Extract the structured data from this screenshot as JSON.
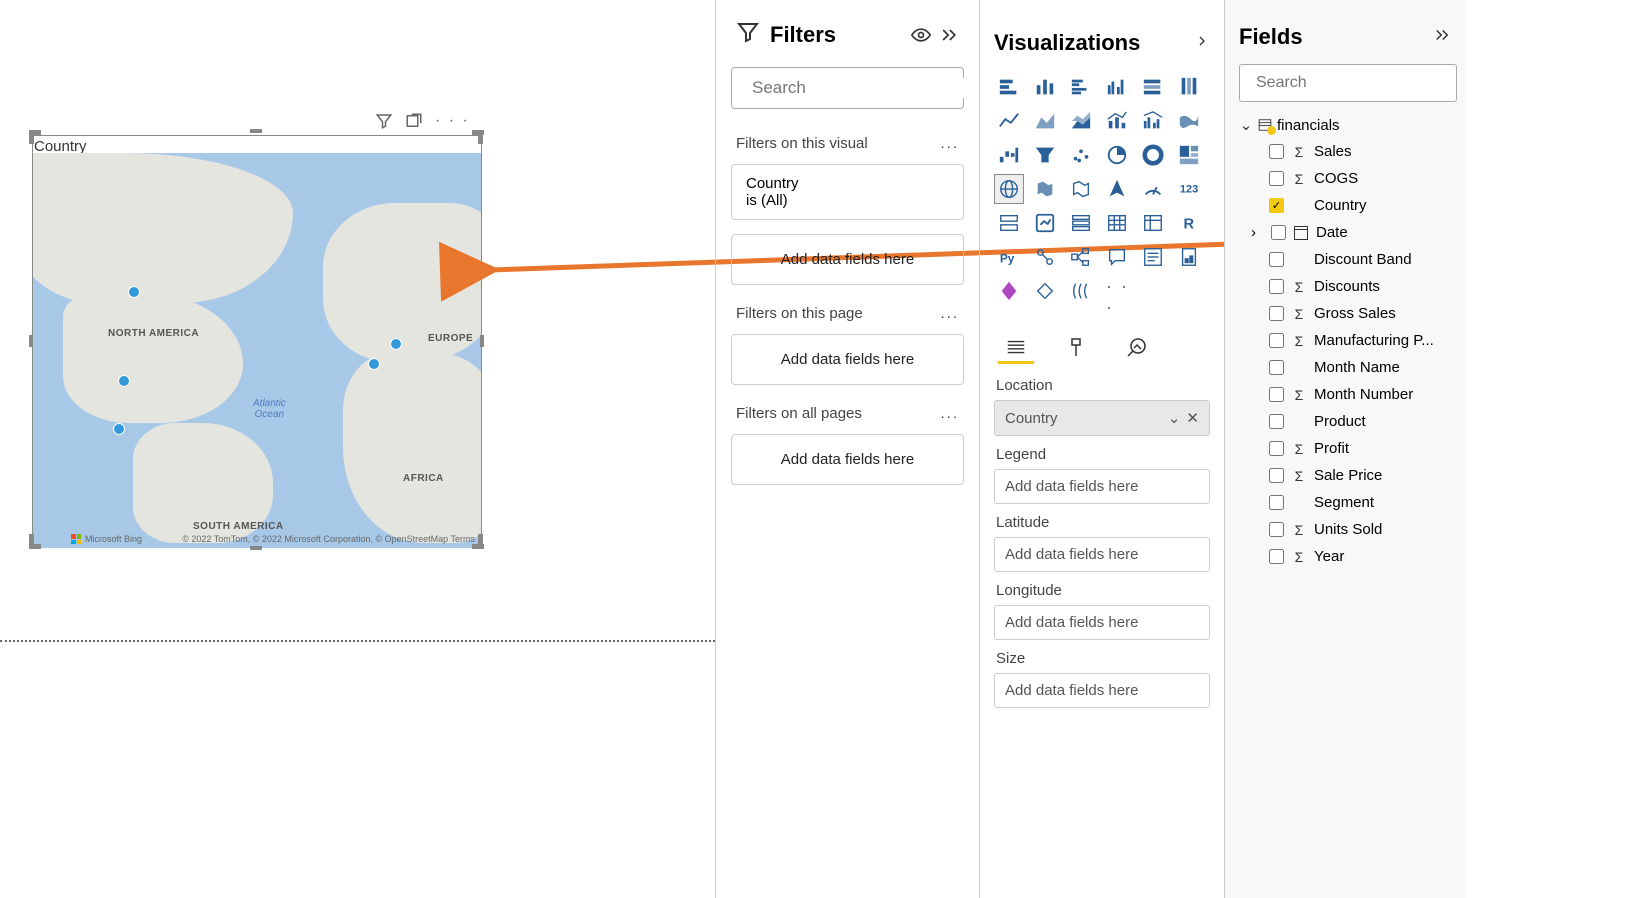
{
  "canvas": {
    "map_title": "Country",
    "continents": {
      "north_america": "NORTH AMERICA",
      "south_america": "SOUTH AMERICA",
      "europe": "EUROPE",
      "africa": "AFRICA"
    },
    "ocean": "Atlantic\nOcean",
    "attribution_vendor": "Microsoft Bing",
    "attribution_text": "© 2022 TomTom, © 2022 Microsoft Corporation,",
    "attribution_link": "© OpenStreetMap",
    "attribution_terms": "Terms"
  },
  "filters": {
    "title": "Filters",
    "search_placeholder": "Search",
    "sections": {
      "visual": {
        "title": "Filters on this visual",
        "card_field": "Country",
        "card_value": "is (All)",
        "placeholder": "Add data fields here"
      },
      "page": {
        "title": "Filters on this page",
        "placeholder": "Add data fields here"
      },
      "all": {
        "title": "Filters on all pages",
        "placeholder": "Add data fields here"
      }
    }
  },
  "viz": {
    "title": "Visualizations",
    "wells": {
      "location": {
        "label": "Location",
        "value": "Country"
      },
      "legend": {
        "label": "Legend",
        "placeholder": "Add data fields here"
      },
      "latitude": {
        "label": "Latitude",
        "placeholder": "Add data fields here"
      },
      "longitude": {
        "label": "Longitude",
        "placeholder": "Add data fields here"
      },
      "size": {
        "label": "Size",
        "placeholder": "Add data fields here"
      }
    }
  },
  "fields": {
    "title": "Fields",
    "search_placeholder": "Search",
    "table_name": "financials",
    "items": [
      {
        "label": "Sales",
        "sigma": true,
        "checked": false
      },
      {
        "label": "COGS",
        "sigma": true,
        "checked": false
      },
      {
        "label": "Country",
        "sigma": false,
        "checked": true
      },
      {
        "label": "Date",
        "date": true,
        "checked": false,
        "expandable": true
      },
      {
        "label": "Discount Band",
        "sigma": false,
        "checked": false
      },
      {
        "label": "Discounts",
        "sigma": true,
        "checked": false
      },
      {
        "label": "Gross Sales",
        "sigma": true,
        "checked": false
      },
      {
        "label": "Manufacturing P...",
        "sigma": true,
        "checked": false
      },
      {
        "label": "Month Name",
        "sigma": false,
        "checked": false
      },
      {
        "label": "Month Number",
        "sigma": true,
        "checked": false
      },
      {
        "label": "Product",
        "sigma": false,
        "checked": false
      },
      {
        "label": "Profit",
        "sigma": true,
        "checked": false
      },
      {
        "label": "Sale Price",
        "sigma": true,
        "checked": false
      },
      {
        "label": "Segment",
        "sigma": false,
        "checked": false
      },
      {
        "label": "Units Sold",
        "sigma": true,
        "checked": false
      },
      {
        "label": "Year",
        "sigma": true,
        "checked": false
      }
    ]
  }
}
